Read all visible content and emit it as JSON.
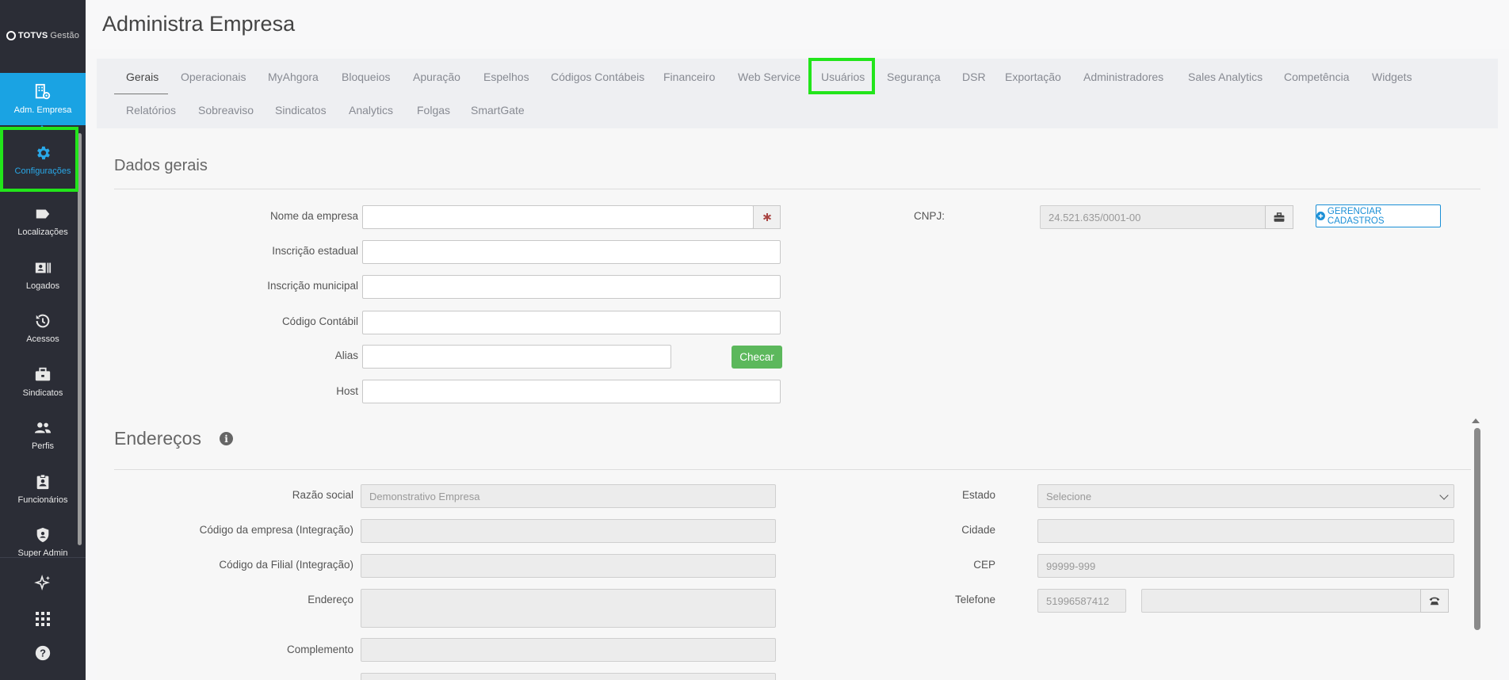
{
  "app": {
    "logo_brand": "TOTVS",
    "logo_suffix": "Gestão"
  },
  "sidebar": {
    "items": [
      {
        "label": "Adm. Empresa",
        "icon": "building-settings-icon"
      },
      {
        "label": "Configurações",
        "icon": "gear-icon"
      },
      {
        "label": "Localizações",
        "icon": "tag-icon"
      },
      {
        "label": "Logados",
        "icon": "id-card-icon"
      },
      {
        "label": "Acessos",
        "icon": "history-icon"
      },
      {
        "label": "Sindicatos",
        "icon": "briefcase-icon"
      },
      {
        "label": "Perfis",
        "icon": "users-icon"
      },
      {
        "label": "Funcionários",
        "icon": "clipboard-user-icon"
      },
      {
        "label": "Super Admin",
        "icon": "shield-user-icon"
      }
    ],
    "bottom_icons": [
      "sparkles-icon",
      "apps-grid-icon",
      "help-icon"
    ]
  },
  "header": {
    "title": "Administra Empresa"
  },
  "tabs": {
    "row1": [
      "Gerais",
      "Operacionais",
      "MyAhgora",
      "Bloqueios",
      "Apuração",
      "Espelhos",
      "Códigos Contábeis",
      "Financeiro",
      "Web Service",
      "Usuários",
      "Segurança",
      "DSR",
      "Exportação",
      "Administradores",
      "Sales Analytics",
      "Competência",
      "Widgets"
    ],
    "row2": [
      "Relatórios",
      "Sobreaviso",
      "Sindicatos",
      "Analytics",
      "Folgas",
      "SmartGate"
    ],
    "active": "Gerais"
  },
  "dados_gerais": {
    "title": "Dados gerais",
    "nome_empresa_label": "Nome da empresa",
    "nome_empresa_value": "",
    "inscricao_estadual_label": "Inscrição estadual",
    "inscricao_estadual_value": "",
    "inscricao_municipal_label": "Inscrição municipal",
    "inscricao_municipal_value": "",
    "codigo_contabil_label": "Código Contábil",
    "codigo_contabil_value": "",
    "alias_label": "Alias",
    "alias_value": "",
    "checar_label": "Checar",
    "host_label": "Host",
    "host_value": "",
    "cnpj_label": "CNPJ:",
    "cnpj_value": "24.521.635/0001-00",
    "gerenciar_label": "GERENCIAR CADASTROS"
  },
  "enderecos": {
    "title": "Endereços",
    "razao_social_label": "Razão social",
    "razao_social_value": "Demonstrativo Empresa",
    "codigo_empresa_label": "Código da empresa (Integração)",
    "codigo_empresa_value": "",
    "codigo_filial_label": "Código da Filial (Integração)",
    "codigo_filial_value": "",
    "endereco_label": "Endereço",
    "endereco_value": "",
    "complemento_label": "Complemento",
    "complemento_value": "",
    "estado_label": "Estado",
    "estado_value": "Selecione",
    "cidade_label": "Cidade",
    "cidade_value": "",
    "cep_label": "CEP",
    "cep_placeholder": "99999-999",
    "telefone_label": "Telefone",
    "telefone_value": "51996587412",
    "telefone_extra_value": ""
  },
  "colors": {
    "sidebar_bg": "#2b2d36",
    "active_blue": "#1aa3e3",
    "highlight_green": "#22e51b",
    "button_green": "#5cb85c"
  }
}
